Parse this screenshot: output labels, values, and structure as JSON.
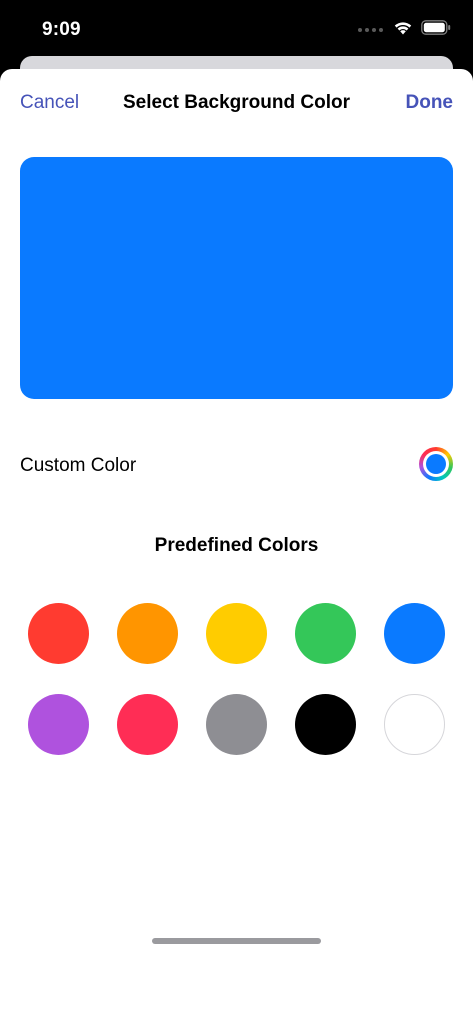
{
  "status_bar": {
    "time": "9:09"
  },
  "nav": {
    "cancel_label": "Cancel",
    "title": "Select Background Color",
    "done_label": "Done",
    "accent_color": "#4653b8"
  },
  "preview": {
    "color": "#0a7aff"
  },
  "custom_color": {
    "label": "Custom Color",
    "current_color": "#0a7aff"
  },
  "predefined": {
    "title": "Predefined Colors",
    "swatches": [
      {
        "name": "red",
        "color": "#ff3b30"
      },
      {
        "name": "orange",
        "color": "#ff9500"
      },
      {
        "name": "yellow",
        "color": "#ffcc00"
      },
      {
        "name": "green",
        "color": "#34c759"
      },
      {
        "name": "blue",
        "color": "#0a7aff"
      },
      {
        "name": "purple",
        "color": "#af52de"
      },
      {
        "name": "pink",
        "color": "#ff2d55"
      },
      {
        "name": "gray",
        "color": "#8e8e93"
      },
      {
        "name": "black",
        "color": "#000000"
      },
      {
        "name": "white",
        "color": "#ffffff"
      }
    ]
  }
}
